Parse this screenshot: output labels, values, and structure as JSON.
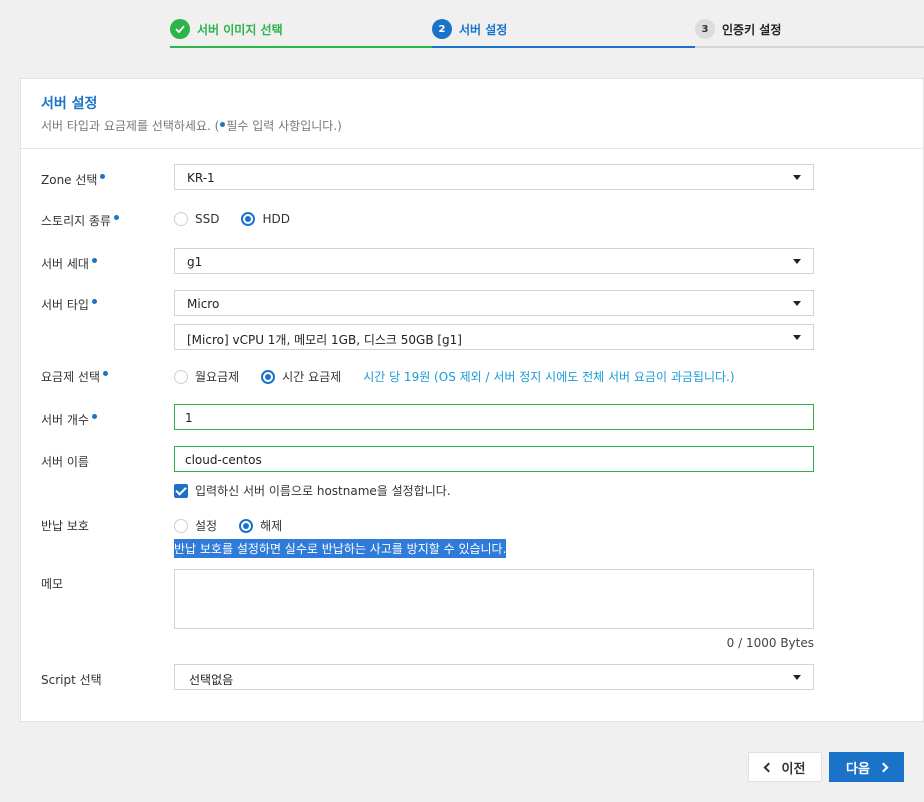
{
  "stepper": {
    "steps": [
      {
        "number": "✓",
        "label": "서버 이미지 선택",
        "state": "done"
      },
      {
        "number": "2",
        "label": "서버 설정",
        "state": "active"
      },
      {
        "number": "3",
        "label": "인증키 설정",
        "state": "todo"
      }
    ]
  },
  "card": {
    "title": "서버 설정",
    "desc_before": "서버 타입과 요금제를 선택하세요. (",
    "desc_after": "필수 입력 사항입니다.)"
  },
  "form": {
    "zone": {
      "label": "Zone 선택",
      "value": "KR-1"
    },
    "storage": {
      "label": "스토리지 종류",
      "options": [
        "SSD",
        "HDD"
      ],
      "selected": "HDD"
    },
    "generation": {
      "label": "서버 세대",
      "value": "g1"
    },
    "server_type": {
      "label": "서버 타입",
      "value": "Micro",
      "spec_value": "[Micro] vCPU 1개, 메모리 1GB, 디스크 50GB [g1]"
    },
    "pricing": {
      "label": "요금제 선택",
      "options": [
        "월요금제",
        "시간 요금제"
      ],
      "selected": "시간 요금제",
      "hint": "시간 당 19원 (OS 제외 / 서버 정지 시에도 전체 서버 요금이 과금됩니다.)"
    },
    "count": {
      "label": "서버 개수",
      "value": "1"
    },
    "name": {
      "label": "서버 이름",
      "value": "cloud-centos",
      "hostname_checkbox": "입력하신 서버 이름으로 hostname을 설정합니다."
    },
    "protection": {
      "label": "반납 보호",
      "options": [
        "설정",
        "해제"
      ],
      "selected": "해제",
      "note": "반납 보호를 설정하면 실수로 반납하는 사고를 방지할 수 있습니다."
    },
    "memo": {
      "label": "메모",
      "value": "",
      "counter": "0 / 1000 Bytes"
    },
    "script": {
      "label": "Script 선택",
      "value": "선택없음"
    }
  },
  "footer": {
    "prev_label": "이전",
    "next_label": "다음"
  },
  "colors": {
    "accent": "#1a73c9",
    "success": "#2db34a",
    "hint": "#1a9bd6"
  }
}
